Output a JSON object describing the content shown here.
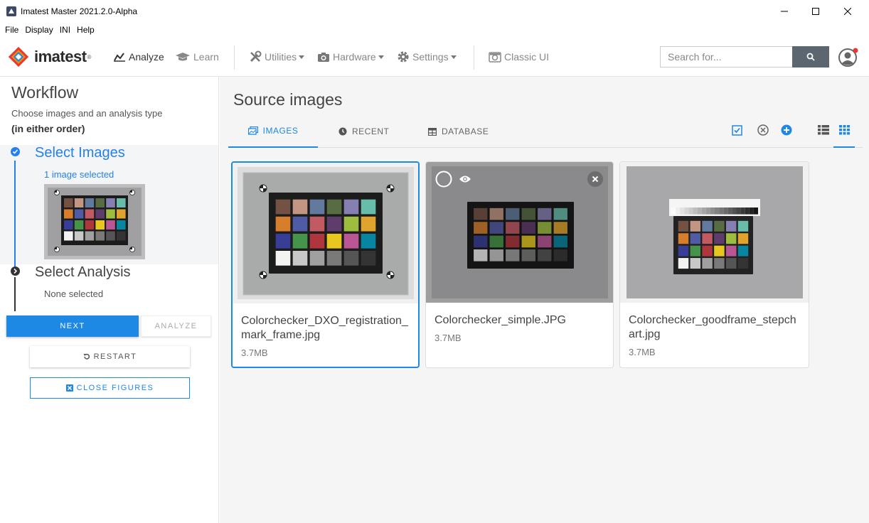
{
  "window": {
    "title": "Imatest Master 2021.2.0-Alpha"
  },
  "menu": [
    "File",
    "Display",
    "INI",
    "Help"
  ],
  "nav": {
    "logo": "imatest",
    "logo_reg": "®",
    "analyze": "Analyze",
    "learn": "Learn",
    "utilities": "Utilities",
    "hardware": "Hardware",
    "settings": "Settings",
    "classic": "Classic UI",
    "search_placeholder": "Search for..."
  },
  "workflow": {
    "title": "Workflow",
    "subtitle": "Choose images and an analysis type",
    "subtitle_bold": "(in either order)",
    "step1_title": "Select Images",
    "step1_sub": "1 image selected",
    "step2_title": "Select Analysis",
    "step2_sub": "None selected",
    "next": "NEXT",
    "analyze": "ANALYZE",
    "restart": "RESTART",
    "close_figures": "CLOSE FIGURES"
  },
  "source": {
    "title": "Source images",
    "tabs": {
      "images": "IMAGES",
      "recent": "RECENT",
      "database": "DATABASE"
    },
    "cards": [
      {
        "name": "Colorchecker_DXO_registration_mark_frame.jpg",
        "size": "3.7MB"
      },
      {
        "name": "Colorchecker_simple.JPG",
        "size": "3.7MB"
      },
      {
        "name": "Colorchecker_goodframe_stepchart.jpg",
        "size": "3.7MB"
      }
    ]
  },
  "colors": {
    "accent": "#1e88e5",
    "patches": [
      "#735244",
      "#c29682",
      "#627a9d",
      "#576c43",
      "#8580b1",
      "#67bdaa",
      "#d67e2c",
      "#505ba6",
      "#c15a63",
      "#5e3c6c",
      "#9dbc40",
      "#e0a32e",
      "#383d96",
      "#469449",
      "#af363c",
      "#e7c71f",
      "#bb5695",
      "#0885a1",
      "#f3f3f2",
      "#c8c8c8",
      "#a0a0a0",
      "#7a7a79",
      "#555555",
      "#343434"
    ]
  }
}
